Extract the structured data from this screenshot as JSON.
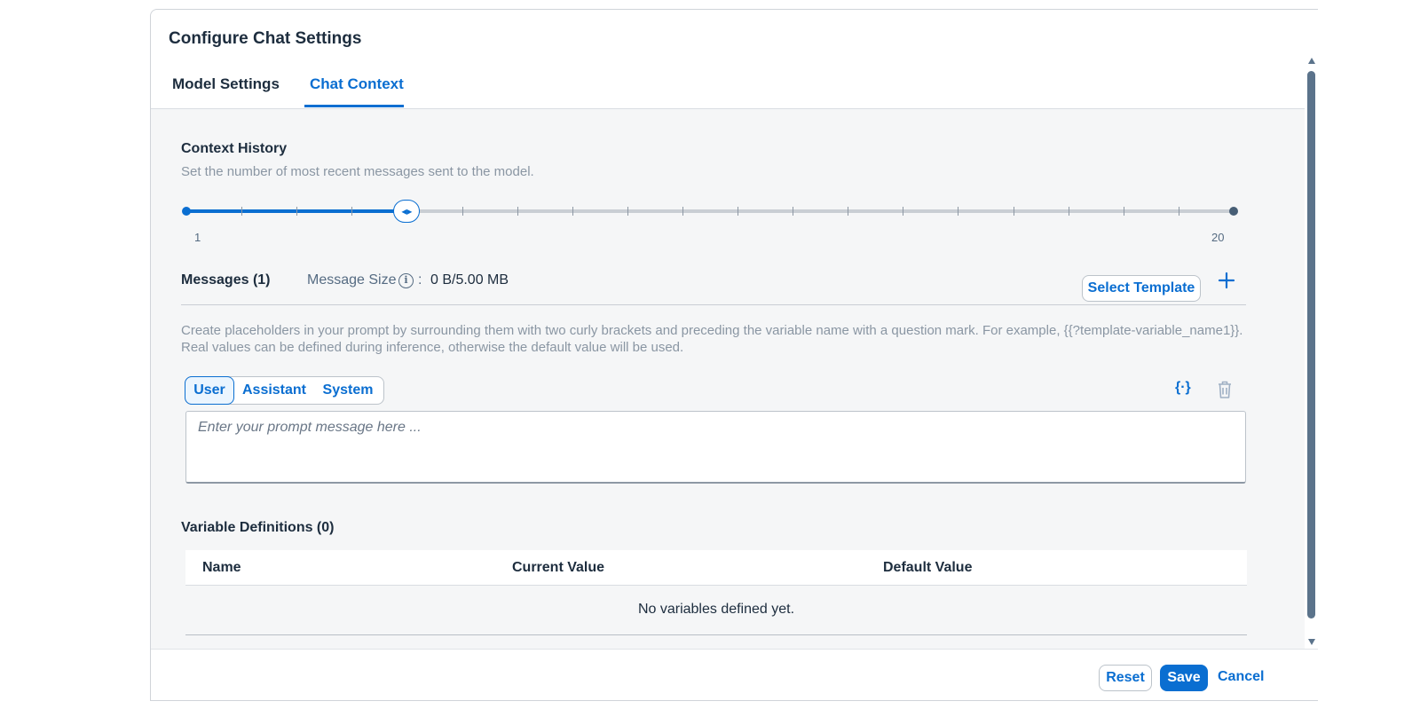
{
  "dialog": {
    "title": "Configure Chat Settings"
  },
  "tabs": [
    {
      "label": "Model Settings",
      "selected": false
    },
    {
      "label": "Chat Context",
      "selected": true
    }
  ],
  "context_history": {
    "title": "Context History",
    "description": "Set the number of most recent messages sent to the model.",
    "slider": {
      "min": 1,
      "max": 20,
      "value": 5,
      "min_label": "1",
      "max_label": "20"
    }
  },
  "messages": {
    "title": "Messages (1)",
    "size_label": "Message Size",
    "size_colon": ":",
    "size_value": "0 B/5.00 MB",
    "select_template_label": "Select Template",
    "hint": "Create placeholders in your prompt by surrounding them with two curly brackets and preceding the variable name with a question mark. For example, {{?template-variable_name1}}. Real values can be defined during inference, otherwise the default value will be used.",
    "roles": [
      {
        "label": "User",
        "selected": true
      },
      {
        "label": "Assistant",
        "selected": false
      },
      {
        "label": "System",
        "selected": false
      }
    ],
    "variable_icon_glyph": "{·}",
    "prompt_placeholder": "Enter your prompt message here ...",
    "prompt_value": ""
  },
  "variables": {
    "title": "Variable Definitions (0)",
    "columns": [
      "Name",
      "Current Value",
      "Default Value"
    ],
    "empty_text": "No variables defined yet."
  },
  "footer": {
    "reset_label": "Reset",
    "save_label": "Save",
    "cancel_label": "Cancel"
  },
  "colors": {
    "accent": "#0a6ed1",
    "text": "#1d2d3e",
    "muted": "#8a96a3",
    "background": "#f5f6f7"
  }
}
